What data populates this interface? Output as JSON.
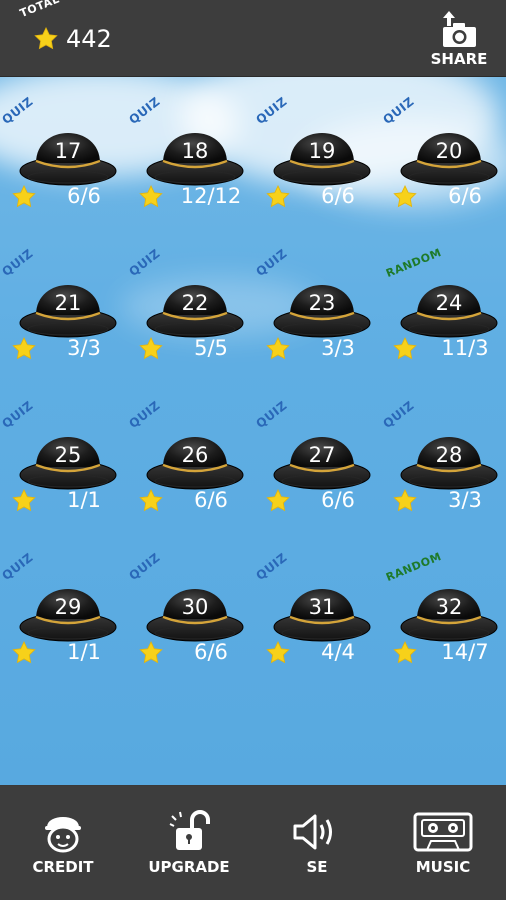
{
  "header": {
    "total_label": "TOTAL",
    "total_value": "442",
    "share_label": "SHARE"
  },
  "colors": {
    "sky": "#5faee3",
    "bar": "#3d3d3d",
    "star": "#f7d11a",
    "quiz_label": "#2a68b8",
    "random_label": "#1e7a2a",
    "hat_band": "#d4a43a"
  },
  "levels": [
    {
      "number": "17",
      "badge": "QUIZ",
      "score": "6/6"
    },
    {
      "number": "18",
      "badge": "QUIZ",
      "score": "12/12"
    },
    {
      "number": "19",
      "badge": "QUIZ",
      "score": "6/6"
    },
    {
      "number": "20",
      "badge": "QUIZ",
      "score": "6/6"
    },
    {
      "number": "21",
      "badge": "QUIZ",
      "score": "3/3"
    },
    {
      "number": "22",
      "badge": "QUIZ",
      "score": "5/5"
    },
    {
      "number": "23",
      "badge": "QUIZ",
      "score": "3/3"
    },
    {
      "number": "24",
      "badge": "RANDOM",
      "score": "11/3"
    },
    {
      "number": "25",
      "badge": "QUIZ",
      "score": "1/1"
    },
    {
      "number": "26",
      "badge": "QUIZ",
      "score": "6/6"
    },
    {
      "number": "27",
      "badge": "QUIZ",
      "score": "6/6"
    },
    {
      "number": "28",
      "badge": "QUIZ",
      "score": "3/3"
    },
    {
      "number": "29",
      "badge": "QUIZ",
      "score": "1/1"
    },
    {
      "number": "30",
      "badge": "QUIZ",
      "score": "6/6"
    },
    {
      "number": "31",
      "badge": "QUIZ",
      "score": "4/4"
    },
    {
      "number": "32",
      "badge": "RANDOM",
      "score": "14/7"
    }
  ],
  "bottom_nav": [
    {
      "label": "CREDIT",
      "icon": "face-icon"
    },
    {
      "label": "UPGRADE",
      "icon": "unlock-icon"
    },
    {
      "label": "SE",
      "icon": "speaker-icon"
    },
    {
      "label": "MUSIC",
      "icon": "cassette-icon"
    }
  ]
}
